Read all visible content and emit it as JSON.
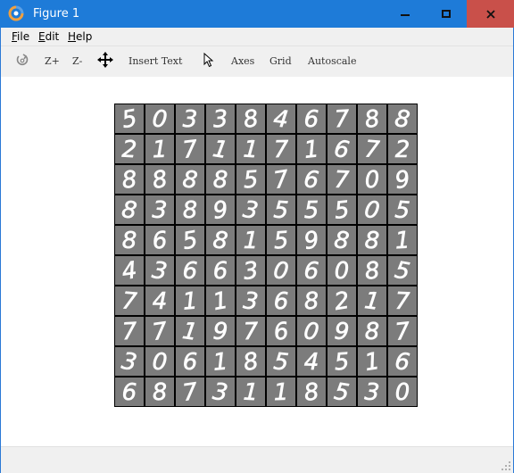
{
  "window": {
    "title": "Figure 1"
  },
  "menu": [
    "File",
    "Edit",
    "Help"
  ],
  "toolbar": {
    "zoom_in": "Z+",
    "zoom_out": "Z-",
    "insert_text": "Insert Text",
    "axes": "Axes",
    "grid": "Grid",
    "autoscale": "Autoscale"
  },
  "figure": {
    "rows": 10,
    "cols": 10,
    "digits": [
      "5",
      "0",
      "3",
      "3",
      "8",
      "4",
      "6",
      "7",
      "8",
      "8",
      "2",
      "1",
      "7",
      "1",
      "1",
      "7",
      "1",
      "6",
      "7",
      "2",
      "8",
      "8",
      "8",
      "8",
      "5",
      "7",
      "6",
      "7",
      "0",
      "9",
      "8",
      "3",
      "8",
      "9",
      "3",
      "5",
      "5",
      "5",
      "0",
      "5",
      "8",
      "6",
      "5",
      "8",
      "1",
      "5",
      "9",
      "8",
      "8",
      "1",
      "4",
      "3",
      "6",
      "6",
      "3",
      "0",
      "6",
      "0",
      "8",
      "5",
      "7",
      "4",
      "1",
      "1",
      "3",
      "6",
      "8",
      "2",
      "1",
      "7",
      "7",
      "7",
      "1",
      "9",
      "7",
      "6",
      "0",
      "9",
      "8",
      "7",
      "3",
      "0",
      "6",
      "1",
      "8",
      "5",
      "4",
      "5",
      "1",
      "6",
      "6",
      "8",
      "7",
      "3",
      "1",
      "1",
      "8",
      "5",
      "3",
      "0"
    ],
    "colors": {
      "cell_bg": "#7c7c7c",
      "stroke": "#ffffff",
      "grid_line": "#000000"
    }
  }
}
